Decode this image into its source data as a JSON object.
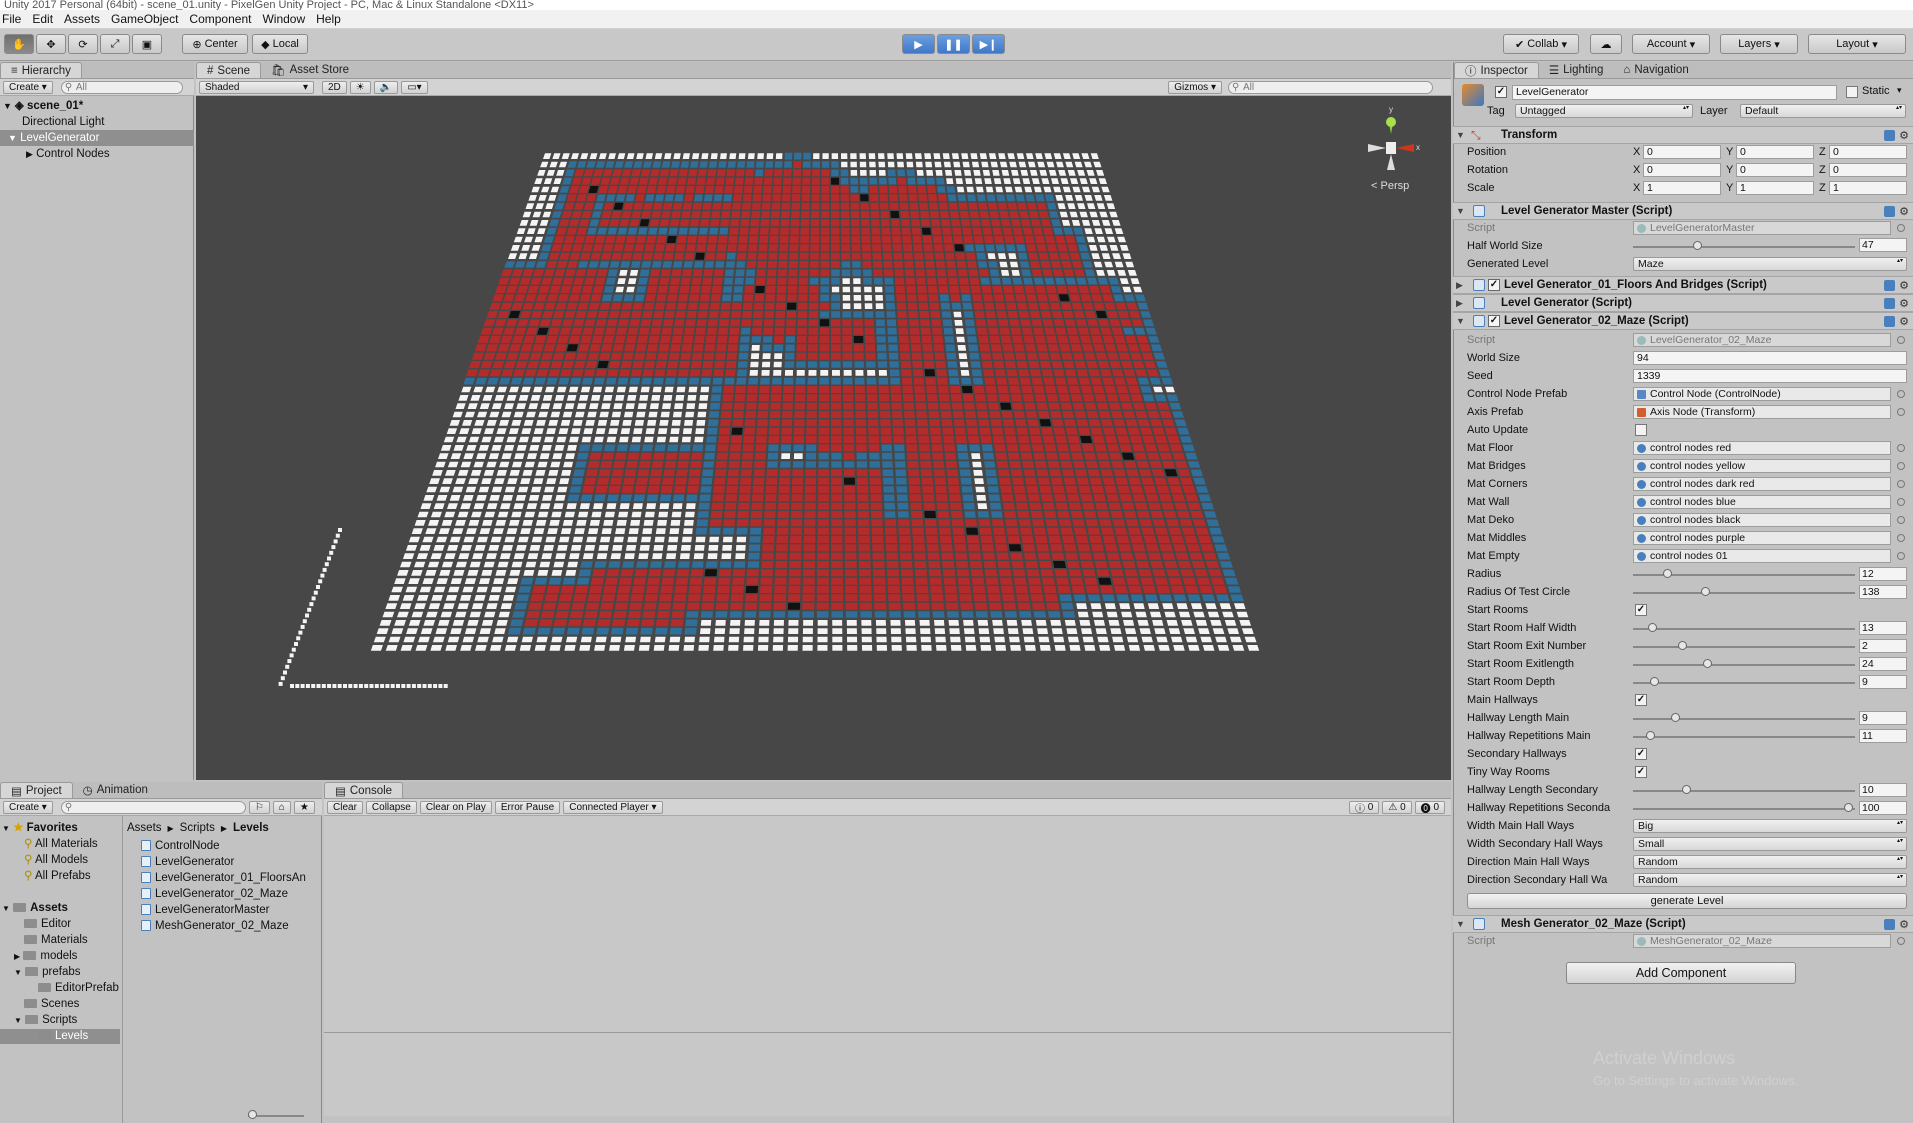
{
  "window": {
    "title": "Unity 2017 Personal (64bit) - scene_01.unity - PixelGen Unity Project - PC, Mac & Linux Standalone <DX11>"
  },
  "menu": [
    "File",
    "Edit",
    "Assets",
    "GameObject",
    "Component",
    "Window",
    "Help"
  ],
  "toolbar": {
    "pivot": "Center",
    "space": "Local",
    "collab": "Collab",
    "account": "Account",
    "layers": "Layers",
    "layout": "Layout"
  },
  "hierarchy": {
    "tab": "Hierarchy",
    "create": "Create",
    "search": "All",
    "scene": "scene_01*",
    "items": [
      "Directional Light",
      "LevelGenerator",
      "Control Nodes"
    ]
  },
  "scene": {
    "tab": "Scene",
    "tab2": "Asset Store",
    "shading": "Shaded",
    "mode2d": "2D",
    "gizmos": "Gizmos",
    "search": "All",
    "persp": "Persp",
    "gizmo_y": "y",
    "gizmo_x": "x"
  },
  "inspector": {
    "tabs": [
      "Inspector",
      "Lighting",
      "Navigation"
    ],
    "object_name": "LevelGenerator",
    "static": "Static",
    "tag_label": "Tag",
    "tag": "Untagged",
    "layer_label": "Layer",
    "layer": "Default",
    "transform": {
      "title": "Transform",
      "position": {
        "label": "Position",
        "x": "0",
        "y": "0",
        "z": "0"
      },
      "rotation": {
        "label": "Rotation",
        "x": "0",
        "y": "0",
        "z": "0"
      },
      "scale": {
        "label": "Scale",
        "x": "1",
        "y": "1",
        "z": "1"
      }
    },
    "master": {
      "title": "Level Generator Master (Script)",
      "script_label": "Script",
      "script": "LevelGeneratorMaster",
      "hws_label": "Half World Size",
      "hws": "47",
      "hws_fraction": 0.28,
      "gl_label": "Generated Level",
      "gl": "Maze"
    },
    "comp2": "Level Generator_01_Floors And Bridges (Script)",
    "comp3": "Level Generator (Script)",
    "comp4": "Level Generator_02_Maze (Script)",
    "maze": {
      "script_label": "Script",
      "script": "LevelGenerator_02_Maze",
      "world_size_label": "World Size",
      "world_size": "94",
      "seed_label": "Seed",
      "seed": "1339",
      "cnp_label": "Control Node Prefab",
      "cnp": "Control Node (ControlNode)",
      "axis_label": "Axis Prefab",
      "axis": "Axis Node (Transform)",
      "auto_label": "Auto Update",
      "mats": [
        {
          "label": "Mat Floor",
          "value": "control nodes red"
        },
        {
          "label": "Mat Bridges",
          "value": "control nodes yellow"
        },
        {
          "label": "Mat Corners",
          "value": "control nodes dark red"
        },
        {
          "label": "Mat Wall",
          "value": "control nodes blue"
        },
        {
          "label": "Mat Deko",
          "value": "control nodes black"
        },
        {
          "label": "Mat Middles",
          "value": "control nodes purple"
        },
        {
          "label": "Mat Empty",
          "value": "control nodes 01"
        }
      ],
      "sliders": [
        {
          "label": "Radius",
          "value": "12",
          "frac": 0.14
        },
        {
          "label": "Radius Of Test Circle",
          "value": "138",
          "frac": 0.32
        },
        {
          "label": "Start Rooms",
          "check": true
        },
        {
          "label": "Start Room Half Width",
          "value": "13",
          "frac": 0.07
        },
        {
          "label": "Start Room Exit Number",
          "value": "2",
          "frac": 0.21
        },
        {
          "label": "Start Room Exitlength",
          "value": "24",
          "frac": 0.33
        },
        {
          "label": "Start Room Depth",
          "value": "9",
          "frac": 0.08
        },
        {
          "label": "Main Hallways",
          "check": true
        },
        {
          "label": "Hallway Length Main",
          "value": "9",
          "frac": 0.18
        },
        {
          "label": "Hallway Repetitions Main",
          "value": "11",
          "frac": 0.06
        },
        {
          "label": "Secondary Hallways",
          "check": true
        },
        {
          "label": "Tiny Way Rooms",
          "check": true
        },
        {
          "label": "Hallway Length Secondary",
          "value": "10",
          "frac": 0.23
        },
        {
          "label": "Hallway Repetitions Seconda",
          "value": "100",
          "frac": 0.99
        }
      ],
      "dropdowns": [
        {
          "label": "Width Main Hall Ways",
          "value": "Big"
        },
        {
          "label": "Width Secondary Hall Ways",
          "value": "Small"
        },
        {
          "label": "Direction Main Hall Ways",
          "value": "Random"
        },
        {
          "label": "Direction Secondary Hall Wa",
          "value": "Random"
        }
      ],
      "generate": "generate Level"
    },
    "mesh": {
      "title": "Mesh Generator_02_Maze (Script)",
      "script_label": "Script",
      "script": "MeshGenerator_02_Maze"
    },
    "add_component": "Add Component"
  },
  "project": {
    "tab": "Project",
    "tab2": "Animation",
    "create": "Create",
    "favorites": "Favorites",
    "fav_items": [
      "All Materials",
      "All Models",
      "All Prefabs"
    ],
    "assets": "Assets",
    "asset_folders": [
      "Editor",
      "Materials",
      "models",
      "prefabs",
      "EditorPrefab",
      "Scenes",
      "Scripts",
      "Levels"
    ],
    "breadcrumb": [
      "Assets",
      "Scripts",
      "Levels"
    ],
    "files": [
      "ControlNode",
      "LevelGenerator",
      "LevelGenerator_01_FloorsAn",
      "LevelGenerator_02_Maze",
      "LevelGeneratorMaster",
      "MeshGenerator_02_Maze"
    ]
  },
  "console": {
    "tab": "Console",
    "buttons": [
      "Clear",
      "Collapse",
      "Clear on Play",
      "Error Pause",
      "Connected Player"
    ],
    "counts": [
      "0",
      "0",
      "0"
    ]
  },
  "watermark": {
    "line1": "Activate Windows",
    "line2": "Go to Settings to activate Windows."
  },
  "colors": {
    "floor": "#b52a2a",
    "wall": "#2f6f9a",
    "empty": "#f4f4f4",
    "deko": "#111111",
    "viewport": "#474747"
  }
}
